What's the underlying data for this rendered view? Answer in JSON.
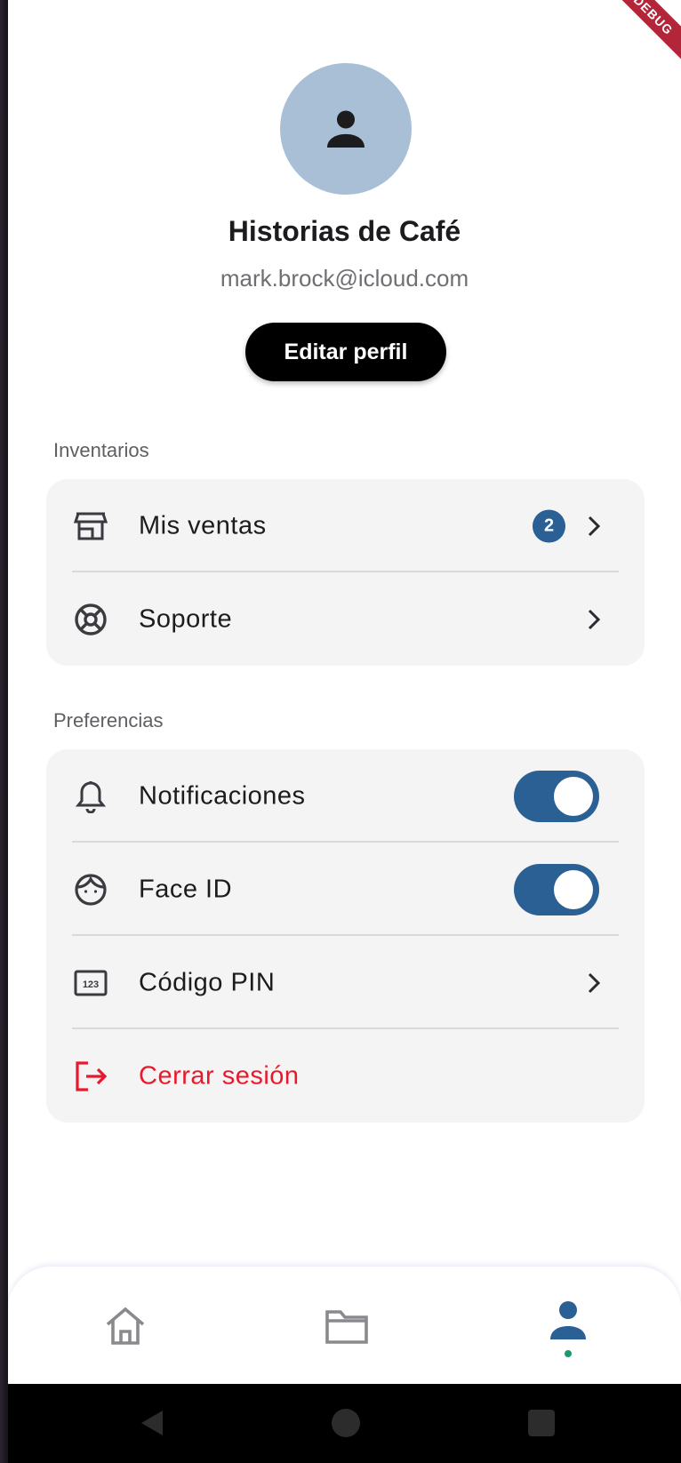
{
  "debug_ribbon": "DEBUG",
  "profile": {
    "name": "Historias de Café",
    "email": "mark.brock@icloud.com",
    "edit_label": "Editar perfil"
  },
  "sections": {
    "inventory_title": "Inventarios",
    "preferences_title": "Preferencias"
  },
  "inventory": {
    "sales_label": "Mis ventas",
    "sales_badge": "2",
    "support_label": "Soporte"
  },
  "preferences": {
    "notifications_label": "Notificaciones",
    "notifications_on": true,
    "faceid_label": "Face ID",
    "faceid_on": true,
    "pin_label": "Código PIN",
    "logout_label": "Cerrar sesión"
  },
  "nav": {
    "items": [
      "home-icon",
      "folder-icon",
      "person-icon"
    ],
    "active": "person-icon"
  },
  "colors": {
    "accent": "#2b6095",
    "danger": "#e8192c",
    "avatar_bg": "#a9bfd6",
    "active_dot": "#1c9a6b"
  }
}
